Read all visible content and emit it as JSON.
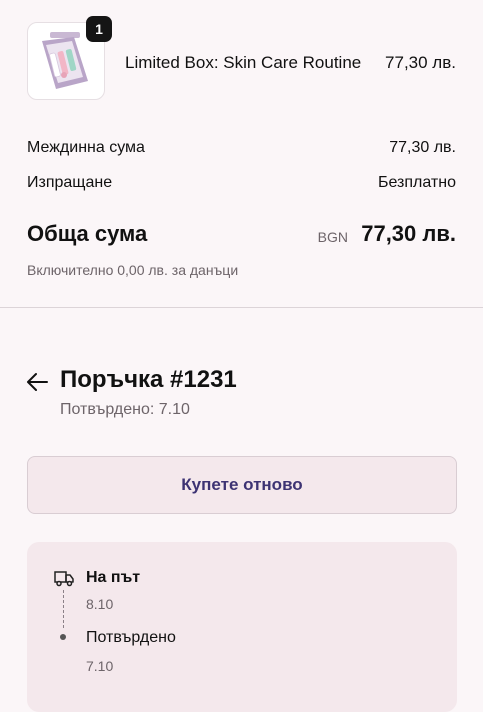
{
  "product": {
    "quantity": "1",
    "name": "Limited Box: Skin Care Routine",
    "price": "77,30 лв.",
    "image_icon": "skin-care-box-image"
  },
  "summary": {
    "subtotal_label": "Междинна сума",
    "subtotal_value": "77,30 лв.",
    "shipping_label": "Изпращане",
    "shipping_value": "Безплатно",
    "total_label": "Обща сума",
    "total_currency": "BGN",
    "total_value": "77,30 лв.",
    "tax_note": "Включително 0,00 лв. за данъци"
  },
  "order": {
    "back_icon": "arrow-left-icon",
    "title": "Поръчка #1231",
    "confirmed": "Потвърдено: 7.10",
    "buy_again_label": "Купете отново"
  },
  "timeline": {
    "steps": [
      {
        "icon": "truck-icon",
        "title": "На път",
        "date": "8.10"
      },
      {
        "icon": "dot-icon",
        "title": "Потвърдено",
        "date": "7.10"
      }
    ]
  },
  "colors": {
    "background": "#fbf6f8",
    "card": "#f4e8ec",
    "accent_text": "#3d3373",
    "muted_text": "#6d6469"
  }
}
